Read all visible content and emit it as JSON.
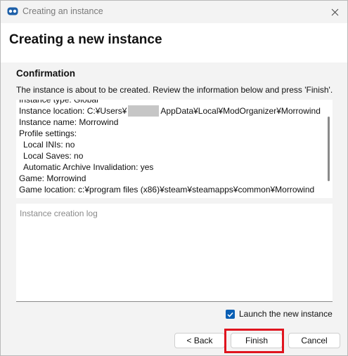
{
  "window": {
    "title": "Creating an instance",
    "app_icon": "mod-organizer-icon",
    "close_icon": "close-icon"
  },
  "header": {
    "title": "Creating a new instance"
  },
  "confirmation": {
    "heading": "Confirmation",
    "description": "The instance is about to be created. Review the information below and press 'Finish'.",
    "lines": {
      "instance_type": "Instance type: Global",
      "location_prefix": "Instance location: C:¥Users¥",
      "location_suffix": "AppData¥Local¥ModOrganizer¥Morrowind",
      "instance_name": "Instance name: Morrowind",
      "profile_settings": "Profile settings:",
      "local_inis": "Local INIs: no",
      "local_saves": "Local Saves: no",
      "archive_invalidation": "Automatic Archive Invalidation: yes",
      "game": "Game: Morrowind",
      "game_location": "Game location: c:¥program files (x86)¥steam¥steamapps¥common¥Morrowind"
    }
  },
  "log": {
    "placeholder": "Instance creation log"
  },
  "launch_checkbox": {
    "label": "Launch the new instance",
    "checked": true
  },
  "buttons": {
    "back": "< Back",
    "finish": "Finish",
    "cancel": "Cancel"
  },
  "colors": {
    "accent": "#0a5fb4",
    "highlight": "#e0141e"
  }
}
